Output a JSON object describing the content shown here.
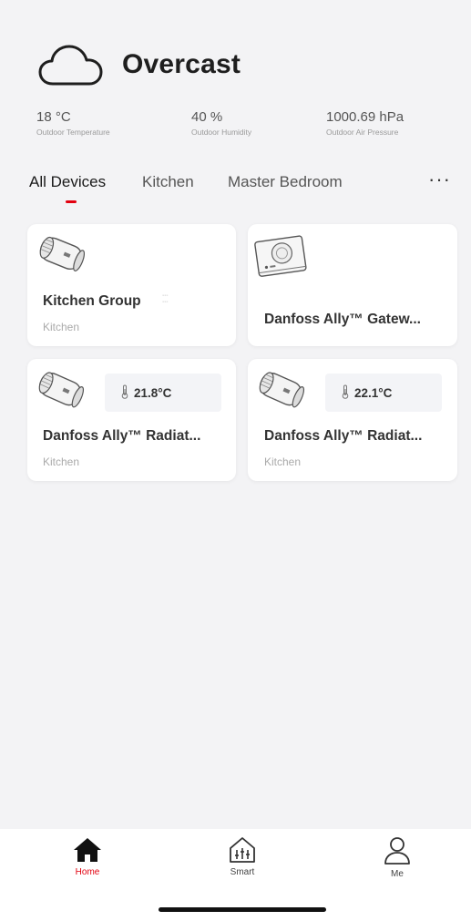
{
  "weather": {
    "condition": "Overcast",
    "icon": "cloud-icon"
  },
  "stats": [
    {
      "value": "18 °C",
      "label": "Outdoor Temperature"
    },
    {
      "value": "40 %",
      "label": "Outdoor Humidity"
    },
    {
      "value": "1000.69 hPa",
      "label": "Outdoor Air Pressure"
    }
  ],
  "tabs": [
    {
      "label": "All Devices",
      "active": true
    },
    {
      "label": "Kitchen",
      "active": false
    },
    {
      "label": "Master Bedroom",
      "active": false
    }
  ],
  "more_label": "···",
  "devices": [
    {
      "name": "Kitchen Group",
      "room": "Kitchen",
      "icon": "radiator-thermostat-icon"
    },
    {
      "name": "Danfoss Ally™ Gatew...",
      "room": "",
      "icon": "gateway-icon"
    },
    {
      "name": "Danfoss Ally™ Radiat...",
      "room": "Kitchen",
      "temperature": "21.8°C",
      "icon": "radiator-thermostat-icon"
    },
    {
      "name": "Danfoss Ally™ Radiat...",
      "room": "Kitchen",
      "temperature": "22.1°C",
      "icon": "radiator-thermostat-icon"
    }
  ],
  "nav": [
    {
      "label": "Home",
      "icon": "home-icon",
      "active": true
    },
    {
      "label": "Smart",
      "icon": "smart-scene-icon",
      "active": false
    },
    {
      "label": "Me",
      "icon": "person-icon",
      "active": false
    }
  ],
  "colors": {
    "accent": "#e2000f",
    "background": "#f3f3f5",
    "card": "#ffffff"
  }
}
